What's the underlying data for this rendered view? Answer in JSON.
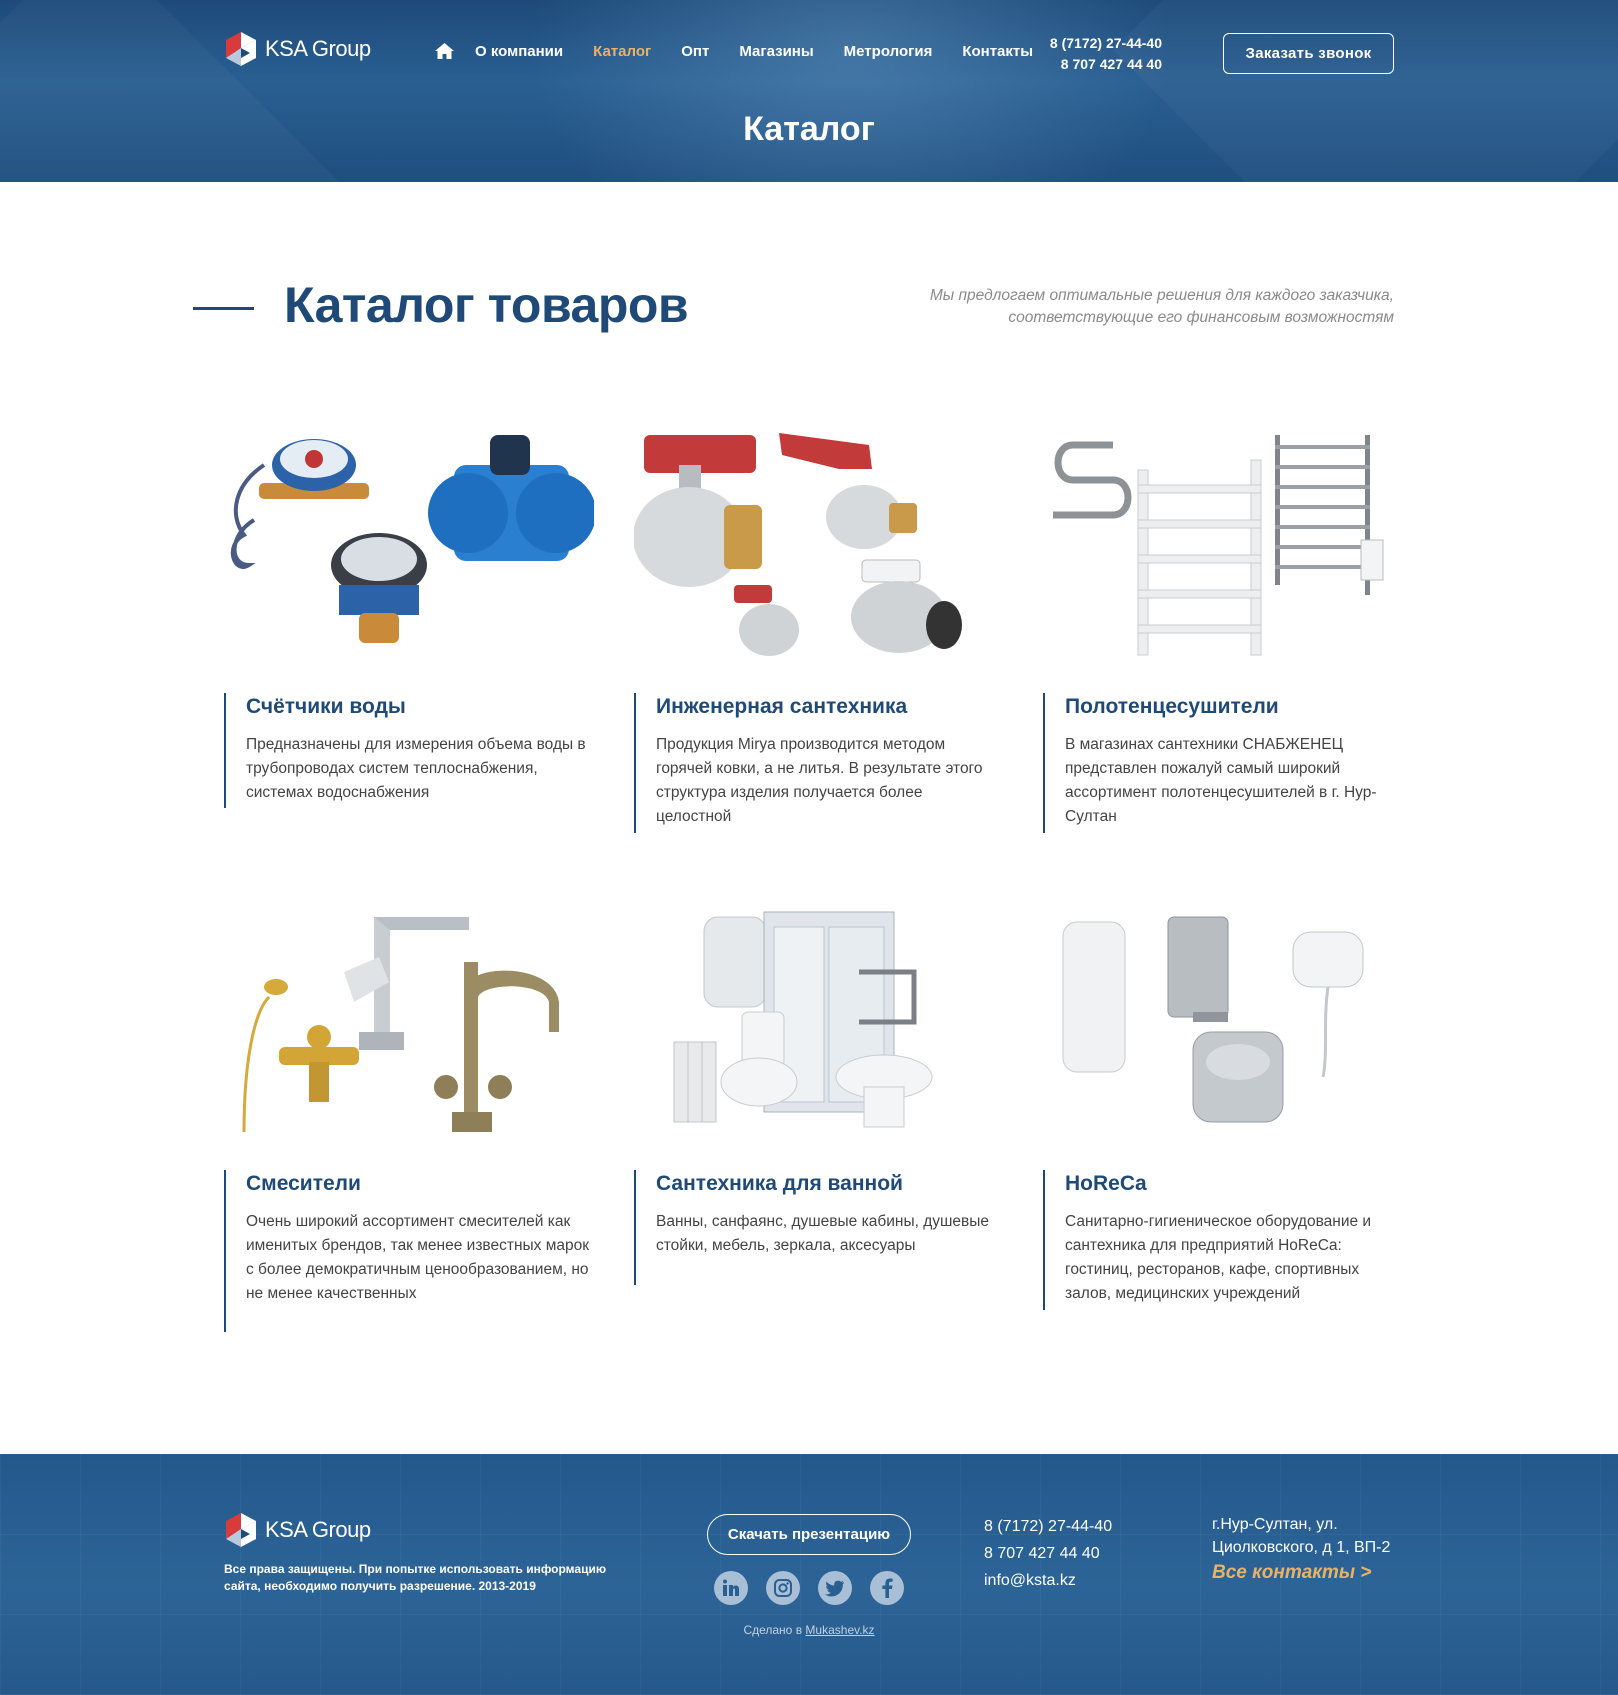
{
  "header": {
    "logo_text": "KSA Group",
    "nav": [
      "О компании",
      "Каталог",
      "Опт",
      "Магазины",
      "Метрология",
      "Контакты"
    ],
    "active_nav": "Каталог",
    "phones": [
      "8 (7172) 27-44-40",
      "8 707 427 44 40"
    ],
    "callback_label": "Заказать звонок",
    "page_title": "Каталог"
  },
  "catalog": {
    "title": "Каталог товаров",
    "subtitle_line1": "Мы предлогаем оптимальные решения для каждого заказчика,",
    "subtitle_line2": "соответствующие его финансовым возможностям",
    "cards": [
      {
        "title": "Счётчики воды",
        "desc": "Предназначены для измерения объема воды в трубопроводах систем теплоснабжения, системах водоснабжения"
      },
      {
        "title": "Инженерная сантехника",
        "desc": "Продукция Mirya производится методом горячей ковки, а не литья. В результате этого структура изделия получается более целостной"
      },
      {
        "title": "Полотенцесушители",
        "desc": "В магазинах сантехники СНАБЖЕНЕЦ представлен пожалуй самый широкий ассортимент полотенцесушителей в г. Нур-Султан"
      },
      {
        "title": "Смесители",
        "desc": "Очень широкий ассортимент смесителей как именитых брендов, так менее известных марок с более демократичным ценообразованием, но не менее качественных"
      },
      {
        "title": "Сантехника для ванной",
        "desc": "Ванны, санфаянс, душевые кабины, душевые стойки, мебель, зеркала, аксесуары"
      },
      {
        "title": "HoReCa",
        "desc": "Санитарно-гигиеническое оборудование и сантехника для предприятий HoReCa: гостиниц, ресторанов, кафе, спортивных залов, медицинских учреждений"
      }
    ]
  },
  "footer": {
    "logo_text": "KSA Group",
    "copyright": "Все права защищены. При попытке использовать информацию сайта, необходимо получить разрешение. 2013-2019",
    "presentation_label": "Скачать презентацию",
    "socials": [
      "linkedin-icon",
      "instagram-icon",
      "twitter-icon",
      "facebook-icon"
    ],
    "made_by_prefix": "Сделано в",
    "made_by_link": "Mukashev.kz",
    "phone1": "8 (7172) 27-44-40",
    "phone2": "8 707 427 44 40",
    "email": "info@ksta.kz",
    "address_line1": "г.Нур-Султан, ул.",
    "address_line2": "Циолковского, д 1, ВП-2",
    "all_contacts": "Все контакты >"
  },
  "colors": {
    "primary": "#1f4a78",
    "accent": "#e9b366",
    "header_bg": "#2a5f92"
  }
}
